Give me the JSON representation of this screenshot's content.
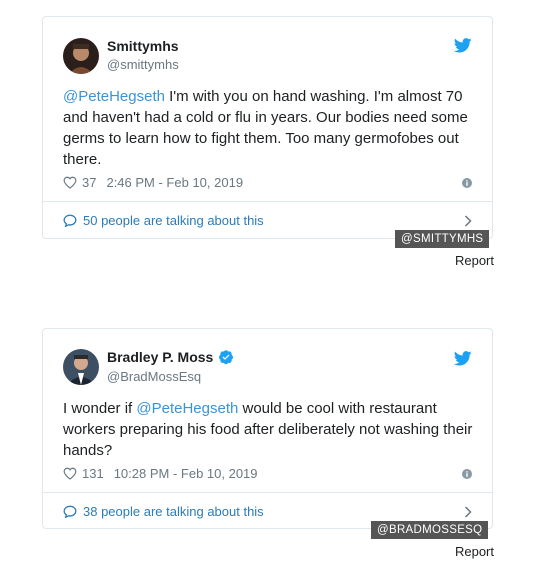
{
  "tweets": [
    {
      "display_name": "Smittymhs",
      "handle": "@smittymhs",
      "text_mention": "@PeteHegseth",
      "text_rest": "  I'm with you on hand washing. I'm almost 70 and haven't had a cold or flu in years.  Our bodies need some germs to learn how to fight them.  Too many germofobes out there.",
      "likes": "37",
      "timestamp": "2:46 PM - Feb 10, 2019",
      "talking": "50 people are talking about this",
      "tag": "@SMITTYMHS",
      "report": "Report",
      "verified": false
    },
    {
      "display_name": "Bradley P. Moss",
      "handle": "@BradMossEsq",
      "text_pre": "I wonder if ",
      "text_mention": "@PeteHegseth",
      "text_rest": " would be cool with restaurant workers preparing his food after deliberately not washing their hands?",
      "likes": "131",
      "timestamp": "10:28 PM - Feb 10, 2019",
      "talking": "38 people are talking about this",
      "tag": "@BRADMOSSESQ",
      "report": "Report",
      "verified": true
    }
  ],
  "colors": {
    "link": "#3b94d9",
    "talk": "#2b7bb9",
    "twitter_bird": "#1da1f2",
    "verified": "#1da1f2",
    "tag_bg": "#555555"
  },
  "icons": [
    "twitter-bird-icon",
    "heart-icon",
    "info-icon",
    "speech-bubble-icon",
    "chevron-right-icon",
    "verified-badge-icon"
  ]
}
